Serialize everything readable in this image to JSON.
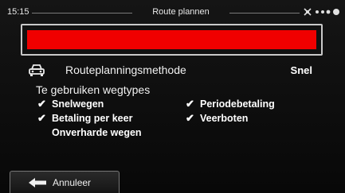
{
  "status_bar": {
    "time": "15:15",
    "title": "Route plannen",
    "icons": [
      "satellite-icon",
      "signal-dots-icon"
    ]
  },
  "progress": {
    "fill_fraction": 1.0,
    "color": "#f00000"
  },
  "routing_method": {
    "icon": "car-icon",
    "label": "Routeplanningsmethode",
    "value": "Snel"
  },
  "road_types": {
    "heading": "Te gebruiken wegtypes",
    "items": [
      {
        "label": "Snelwegen",
        "checked": true
      },
      {
        "label": "Periodebetaling",
        "checked": true
      },
      {
        "label": "Betaling per keer",
        "checked": true
      },
      {
        "label": "Veerboten",
        "checked": true
      },
      {
        "label": "Onverharde wegen",
        "checked": false
      }
    ]
  },
  "cancel_button": {
    "icon": "back-arrow-icon",
    "label": "Annuleer"
  }
}
